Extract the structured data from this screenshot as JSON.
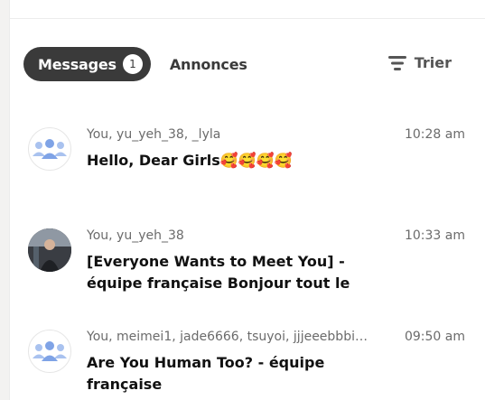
{
  "tabs": {
    "messages_label": "Messages",
    "messages_count": "1",
    "annonces_label": "Annonces"
  },
  "sort": {
    "label": "Trier",
    "icon": "sort-icon"
  },
  "conversations": [
    {
      "participants": "You, yu_yeh_38, _lyla",
      "time": "10:28 am",
      "title": "Hello, Dear Girls🥰🥰🥰🥰",
      "avatar": "group-icon"
    },
    {
      "participants": "You, yu_yeh_38",
      "time": "10:33 am",
      "title": "[Everyone Wants to Meet You] - équipe française Bonjour tout le",
      "avatar": "user-photo"
    },
    {
      "participants": "You, meimei1, jade6666, tsuyoi, jjjeeebbbi…",
      "time": "09:50 am",
      "title": "Are You Human Too? - équipe française",
      "avatar": "group-icon"
    }
  ],
  "colors": {
    "active_tab_bg": "#3a3a3a",
    "group_icon": "#a9c2ef"
  }
}
